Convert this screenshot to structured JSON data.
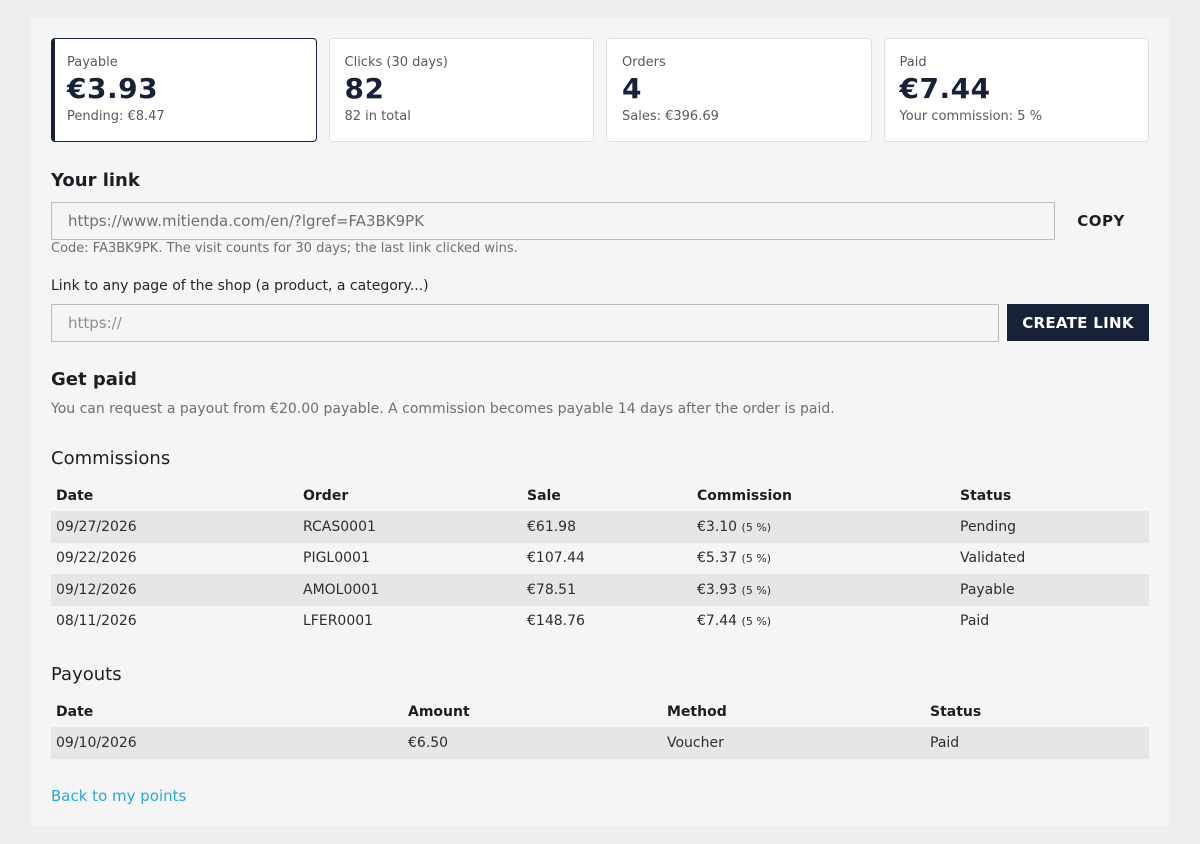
{
  "stats": [
    {
      "label": "Payable",
      "value": "€3.93",
      "sub": "Pending: €8.47"
    },
    {
      "label": "Clicks (30 days)",
      "value": "82",
      "sub": "82 in total"
    },
    {
      "label": "Orders",
      "value": "4",
      "sub": "Sales: €396.69"
    },
    {
      "label": "Paid",
      "value": "€7.44",
      "sub": "Your commission: 5 %"
    }
  ],
  "link_section": {
    "title": "Your link",
    "url": "https://www.mitienda.com/en/?lgref=FA3BK9PK",
    "copy_label": "COPY",
    "hint": "Code: FA3BK9PK. The visit counts for 30 days; the last link clicked wins."
  },
  "deep_link": {
    "label": "Link to any page of the shop (a product, a category...)",
    "placeholder": "https://",
    "create_label": "CREATE LINK"
  },
  "get_paid": {
    "title": "Get paid",
    "text": "You can request a payout from €20.00 payable. A commission becomes payable 14 days after the order is paid."
  },
  "commissions": {
    "title": "Commissions",
    "headers": [
      "Date",
      "Order",
      "Sale",
      "Commission",
      "Status"
    ],
    "rows": [
      {
        "date": "09/27/2026",
        "order": "RCAS0001",
        "sale": "€61.98",
        "commission": "€3.10",
        "rate": "(5 %)",
        "status": "Pending"
      },
      {
        "date": "09/22/2026",
        "order": "PIGL0001",
        "sale": "€107.44",
        "commission": "€5.37",
        "rate": "(5 %)",
        "status": "Validated"
      },
      {
        "date": "09/12/2026",
        "order": "AMOL0001",
        "sale": "€78.51",
        "commission": "€3.93",
        "rate": "(5 %)",
        "status": "Payable"
      },
      {
        "date": "08/11/2026",
        "order": "LFER0001",
        "sale": "€148.76",
        "commission": "€7.44",
        "rate": "(5 %)",
        "status": "Paid"
      }
    ]
  },
  "payouts": {
    "title": "Payouts",
    "headers": [
      "Date",
      "Amount",
      "Method",
      "Status"
    ],
    "rows": [
      {
        "date": "09/10/2026",
        "amount": "€6.50",
        "method": "Voucher",
        "status": "Paid"
      }
    ]
  },
  "back_link": "Back to my points",
  "colors": {
    "accent": "#172238",
    "link": "#2aa8d8"
  }
}
